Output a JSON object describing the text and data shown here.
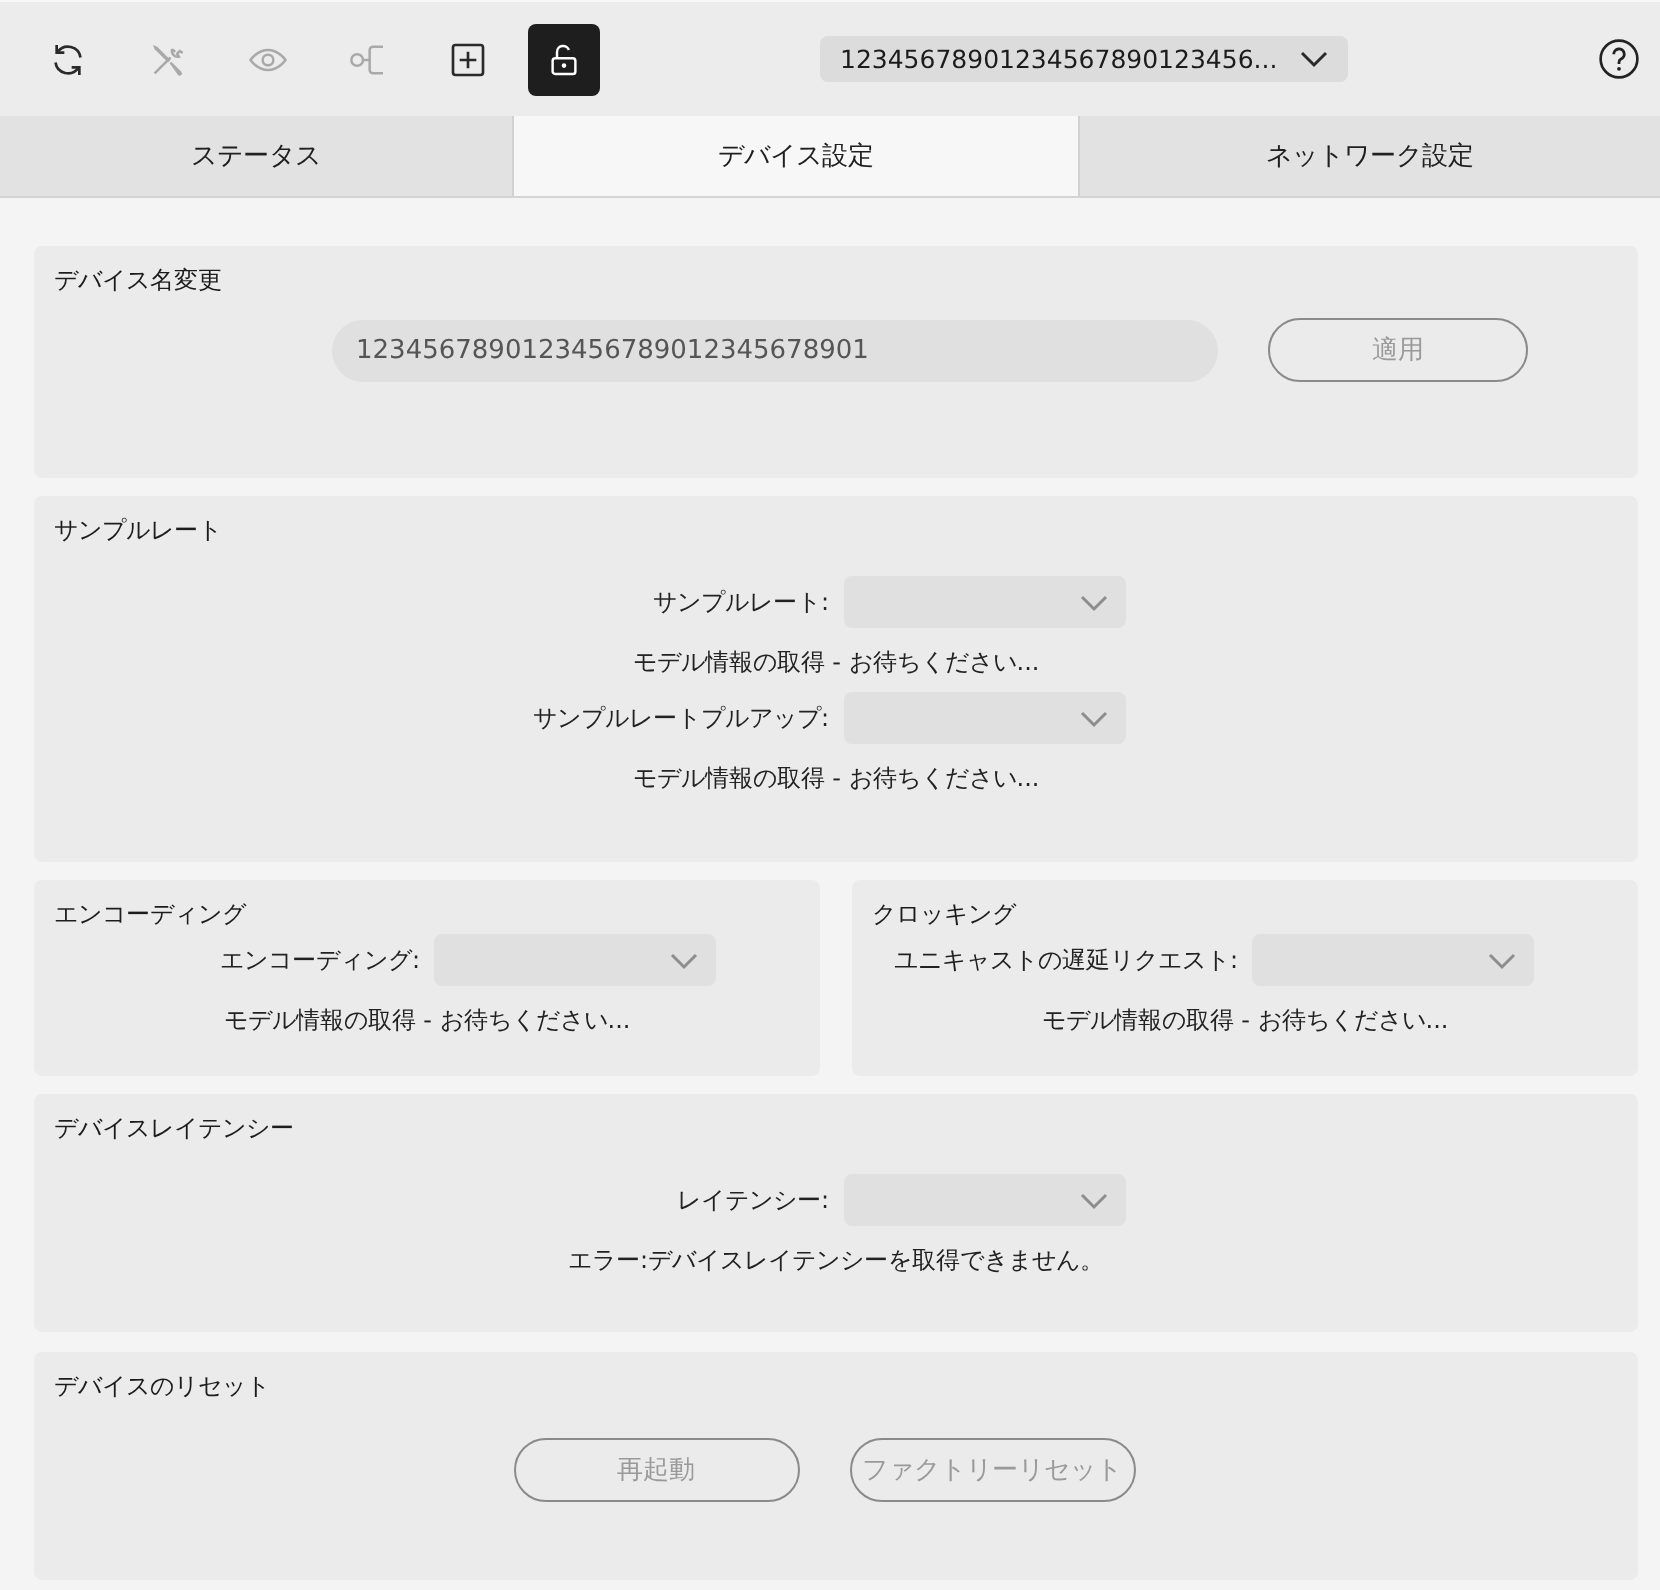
{
  "toolbar": {
    "buttons": [
      {
        "kind": "refresh",
        "disabled": false
      },
      {
        "kind": "tools",
        "disabled": true
      },
      {
        "kind": "eye",
        "disabled": true
      },
      {
        "kind": "branch",
        "disabled": true
      },
      {
        "kind": "add",
        "disabled": false
      }
    ],
    "lock": {
      "on": true
    },
    "device_select": {
      "value": "12345678901234567890123456..."
    }
  },
  "tabs": [
    {
      "label": "ステータス",
      "selected": false
    },
    {
      "label": "デバイス設定",
      "selected": true
    },
    {
      "label": "ネットワーク設定",
      "selected": false
    }
  ],
  "device_name": {
    "title": "デバイス名変更",
    "field": {
      "value": "1234567890123456789012345678901"
    },
    "apply_button": {
      "label": "適用",
      "disabled": true
    }
  },
  "sample_rate": {
    "title": "サンプルレート",
    "rows": [
      {
        "kind": "select",
        "label": "サンプルレート:",
        "disabled": true
      },
      {
        "kind": "status",
        "text": "モデル情報の取得 - お待ちください..."
      },
      {
        "kind": "select",
        "label": "サンプルレートプルアップ:",
        "disabled": true
      },
      {
        "kind": "status",
        "text": "モデル情報の取得 - お待ちください..."
      }
    ]
  },
  "encoding": {
    "title": "エンコーディング",
    "rows": [
      {
        "kind": "select",
        "label": "エンコーディング:",
        "disabled": true
      },
      {
        "kind": "status",
        "text": "モデル情報の取得 - お待ちください..."
      }
    ]
  },
  "clocking": {
    "title": "クロッキング",
    "rows": [
      {
        "kind": "select",
        "label": "ユニキャストの遅延リクエスト:",
        "disabled": true
      },
      {
        "kind": "status",
        "text": "モデル情報の取得 - お待ちください..."
      }
    ]
  },
  "device_latency": {
    "title": "デバイスレイテンシー",
    "rows": [
      {
        "kind": "select",
        "label": "レイテンシー:",
        "disabled": true
      },
      {
        "kind": "status",
        "text": "エラー:デバイスレイテンシーを取得できません。"
      }
    ]
  },
  "device_reset": {
    "title": "デバイスのリセット",
    "buttons": [
      {
        "label": "再起動",
        "disabled": true
      },
      {
        "label": "ファクトリーリセット",
        "disabled": true
      }
    ]
  }
}
